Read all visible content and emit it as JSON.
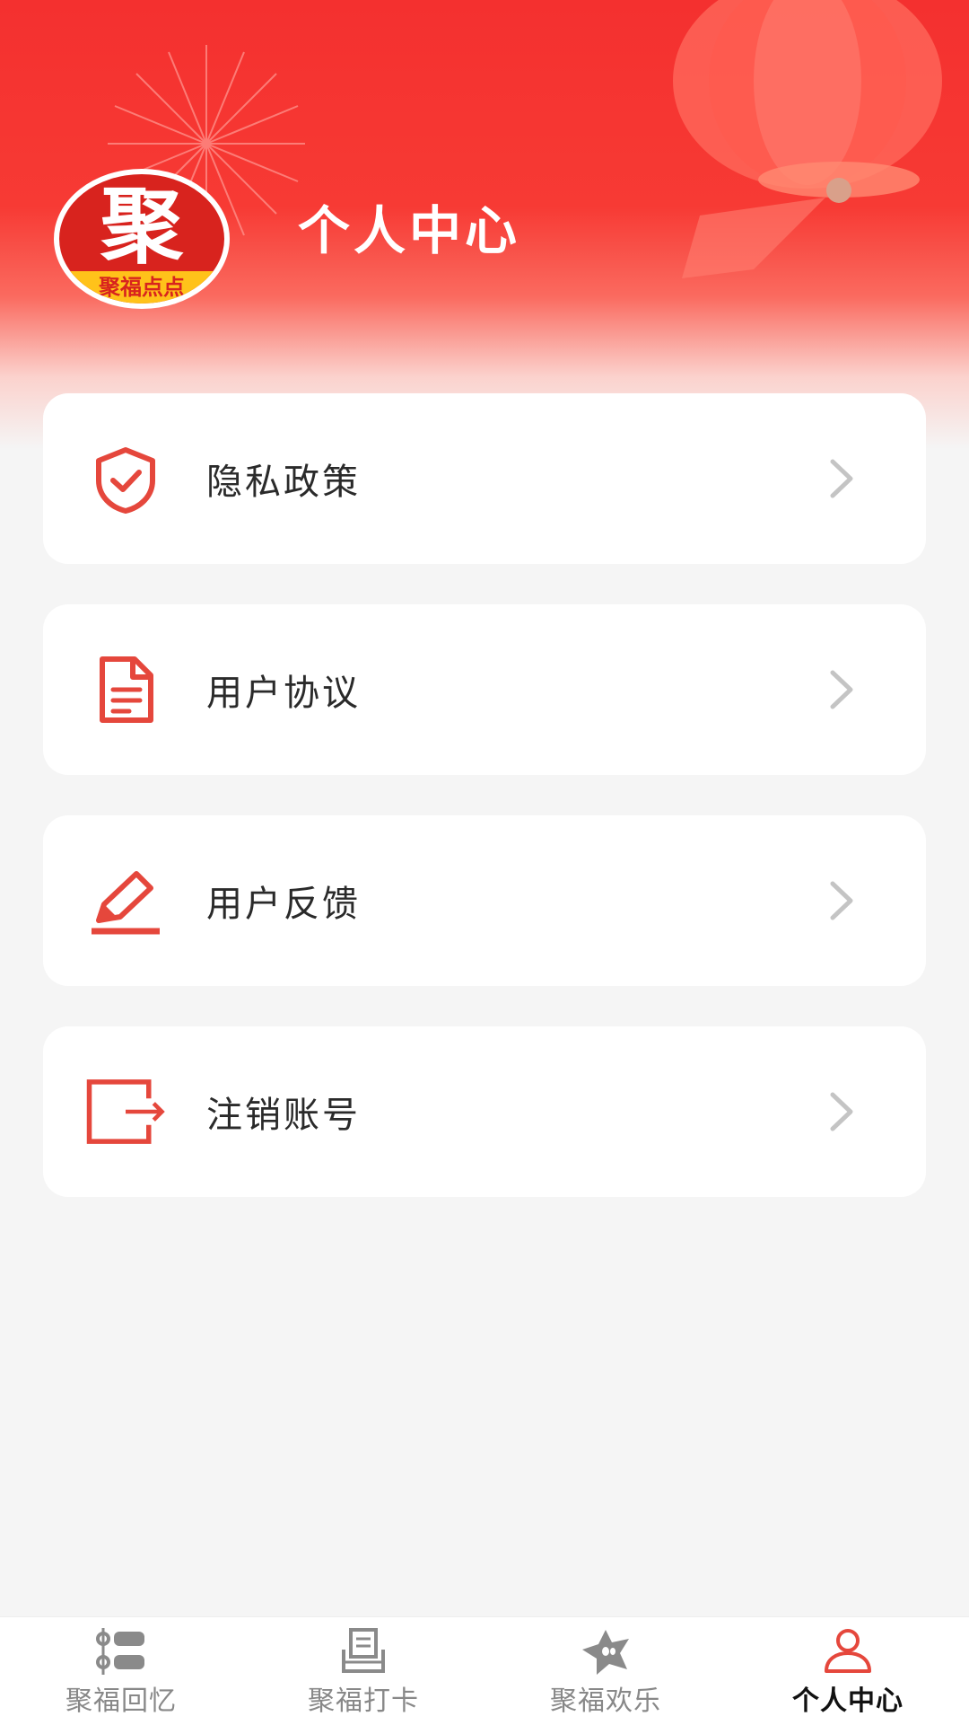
{
  "header": {
    "title": "个人中心",
    "logo": {
      "main_char": "聚",
      "band_text": "聚福点点"
    }
  },
  "menu": [
    {
      "label": "隐私政策",
      "icon": "shield-check-icon"
    },
    {
      "label": "用户协议",
      "icon": "document-icon"
    },
    {
      "label": "用户反馈",
      "icon": "edit-pen-icon"
    },
    {
      "label": "注销账号",
      "icon": "logout-icon"
    }
  ],
  "tabbar": {
    "items": [
      {
        "label": "聚福回忆",
        "icon": "list-icon",
        "active": false
      },
      {
        "label": "聚福打卡",
        "icon": "printer-icon",
        "active": false
      },
      {
        "label": "聚福欢乐",
        "icon": "star-face-icon",
        "active": false
      },
      {
        "label": "个人中心",
        "icon": "user-icon",
        "active": true
      }
    ]
  },
  "colors": {
    "brand_red": "#f4302f",
    "icon_red": "#e5473c",
    "background": "#f5f5f5",
    "chevron": "#c4c4c4"
  }
}
